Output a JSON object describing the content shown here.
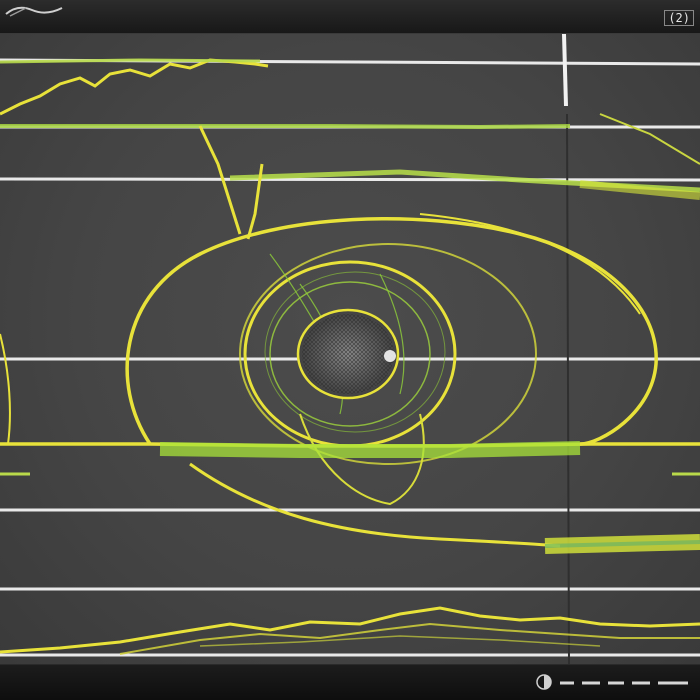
{
  "window": {
    "title": "",
    "badge": "(2)"
  },
  "statusbar": {
    "text": ""
  },
  "colors": {
    "background": "#454545",
    "trace": "#e8e23a",
    "trace_green": "#9fd43c",
    "gridline": "#e9e9e9",
    "chrome": "#1e1e1e"
  },
  "icons": {
    "status": "circle-half-icon"
  }
}
